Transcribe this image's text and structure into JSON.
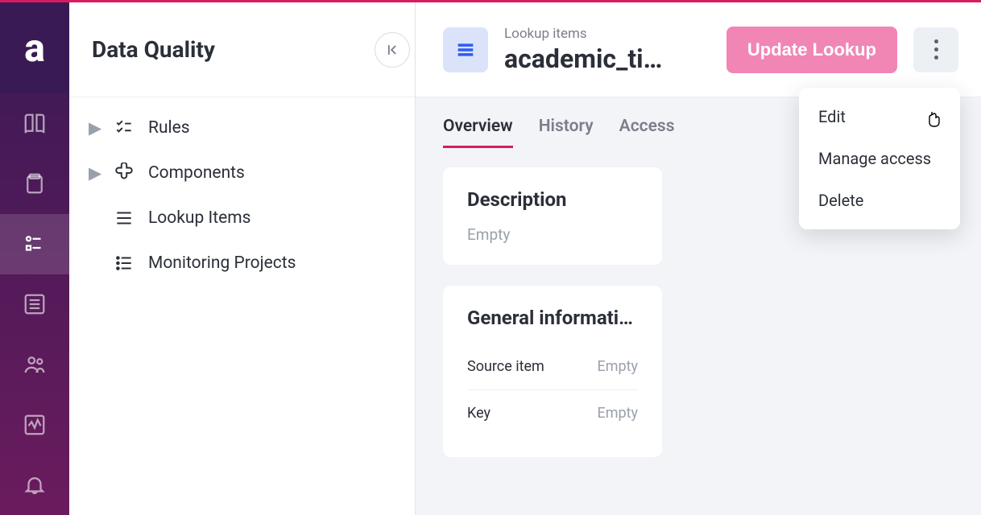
{
  "rail": {
    "logo_text": "a"
  },
  "sidebar": {
    "title": "Data Quality",
    "items": [
      {
        "label": "Rules",
        "has_caret": true
      },
      {
        "label": "Components",
        "has_caret": true
      },
      {
        "label": "Lookup Items",
        "has_caret": false
      },
      {
        "label": "Monitoring Projects",
        "has_caret": false
      }
    ]
  },
  "header": {
    "breadcrumb": "Lookup items",
    "title": "academic_ti…",
    "update_button": "Update Lookup"
  },
  "tabs": [
    {
      "label": "Overview",
      "active": true
    },
    {
      "label": "History",
      "active": false
    },
    {
      "label": "Access",
      "active": false
    }
  ],
  "description_card": {
    "title": "Description",
    "value": "Empty"
  },
  "general_card": {
    "title": "General informati…",
    "rows": [
      {
        "label": "Source item",
        "value": "Empty"
      },
      {
        "label": "Key",
        "value": "Empty"
      }
    ]
  },
  "menu": {
    "items": [
      {
        "label": "Edit"
      },
      {
        "label": "Manage access"
      },
      {
        "label": "Delete"
      }
    ]
  }
}
